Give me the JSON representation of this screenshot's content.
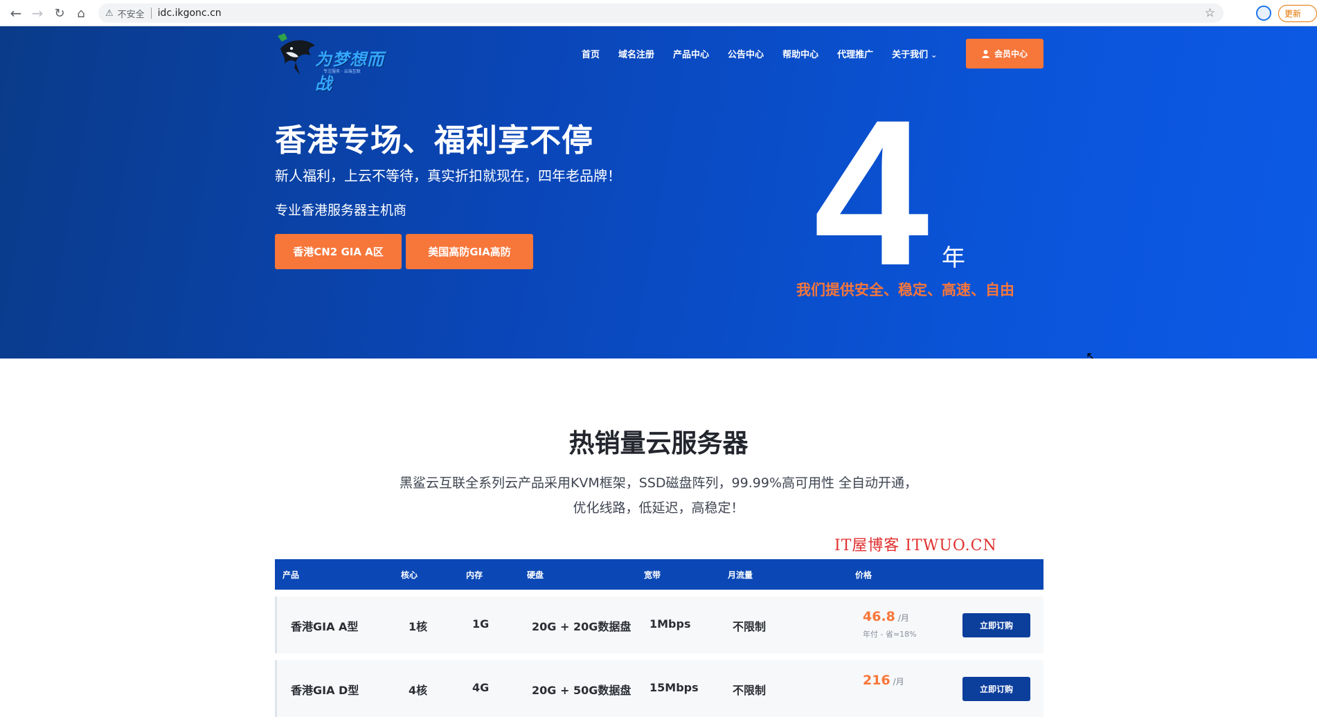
{
  "browser": {
    "url": "idc.ikgonc.cn",
    "security_label": "不安全",
    "update_label": "更新"
  },
  "header": {
    "logo_text": "为梦想而战",
    "logo_sub": "专注服务 · 云端互联",
    "menu": [
      "首页",
      "域名注册",
      "产品中心",
      "公告中心",
      "帮助中心",
      "代理推广",
      "关于我们"
    ],
    "member_label": "会员中心"
  },
  "hero": {
    "title": "香港专场、福利享不停",
    "subtitle": "新人福利，上云不等待，真实折扣就现在，四年老品牌！",
    "tagline": "专业香港服务器主机商",
    "buttons": [
      "香港CN2 GIA A区",
      "美国高防GIA高防"
    ],
    "years_number": "4",
    "years_unit": "年",
    "slogan": "我们提供安全、稳定、高速、自由"
  },
  "section": {
    "title": "热销量云服务器",
    "desc": "黑鲨云互联全系列云产品采用KVM框架，SSD磁盘阵列，99.99%高可用性 全自动开通，优化线路，低延迟，高稳定！",
    "watermark": "IT屋博客 ITWUO.CN"
  },
  "table": {
    "headers": [
      "产品",
      "核心",
      "内存",
      "硬盘",
      "宽带",
      "月流量",
      "价格"
    ],
    "rows": [
      {
        "name": "香港GIA A型",
        "cpu": "1核",
        "ram": "1G",
        "disk": "20G + 20G数据盘",
        "bw": "1Mbps",
        "traffic": "不限制",
        "price": "46.8",
        "per": "/月",
        "note": "年付 - 省≈18%",
        "order": "立即订购"
      },
      {
        "name": "香港GIA D型",
        "cpu": "4核",
        "ram": "4G",
        "disk": "20G + 50G数据盘",
        "bw": "15Mbps",
        "traffic": "不限制",
        "price": "216",
        "per": "/月",
        "note": "",
        "order": "立即订购"
      }
    ]
  },
  "colors": {
    "accent_orange": "#f7763a",
    "hero_blue": "#0a54d8",
    "table_head": "#0b48b5",
    "order_button": "#0c3e9c"
  }
}
